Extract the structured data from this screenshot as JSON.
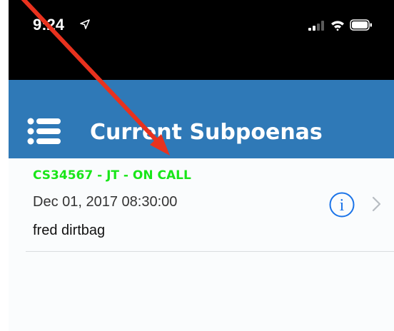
{
  "status_bar": {
    "time": "9:24",
    "icons": [
      "location-arrow-icon",
      "cellular-signal-icon",
      "wifi-icon",
      "battery-icon"
    ]
  },
  "nav": {
    "title": "Current Subpoenas",
    "menu_icon": "hamburger-menu-icon",
    "bar_color": "#2f79b7"
  },
  "subpoenas": [
    {
      "title": "CS34567 - JT - ON CALL",
      "date": "Dec 01, 2017 08:30:00",
      "name": "fred dirtbag",
      "title_color": "#19e619",
      "icons": [
        "info-icon",
        "chevron-right-icon"
      ]
    }
  ],
  "annotation": {
    "type": "red-arrow",
    "color": "#e8321e"
  }
}
